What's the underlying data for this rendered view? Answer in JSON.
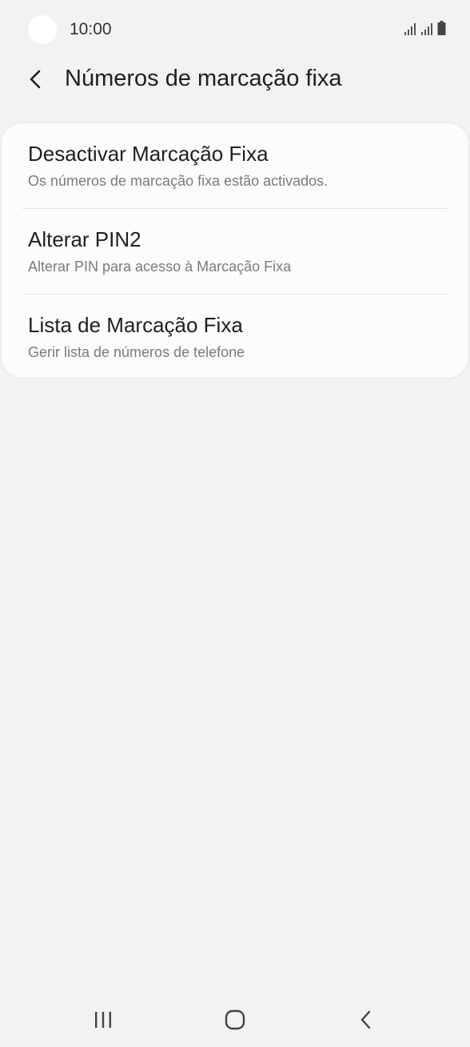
{
  "status_bar": {
    "time": "10:00",
    "icons": [
      "signal-icon",
      "signal-icon",
      "battery-icon"
    ]
  },
  "header": {
    "title": "Números de marcação fixa",
    "back_icon": "back-arrow-icon"
  },
  "list": {
    "items": [
      {
        "title": "Desactivar Marcação Fixa",
        "subtitle": "Os números de marcação fixa estão activados."
      },
      {
        "title": "Alterar PIN2",
        "subtitle": "Alterar PIN para acesso à Marcação Fixa"
      },
      {
        "title": "Lista de Marcação Fixa",
        "subtitle": "Gerir lista de números de telefone"
      }
    ]
  },
  "nav_bar": {
    "icons": [
      "recent-apps-icon",
      "home-icon",
      "back-icon"
    ]
  },
  "colors": {
    "background": "#f2f2f2",
    "card": "#fcfcfc",
    "title_text": "#1f1f1f",
    "subtitle_text": "#7a7a7a"
  }
}
